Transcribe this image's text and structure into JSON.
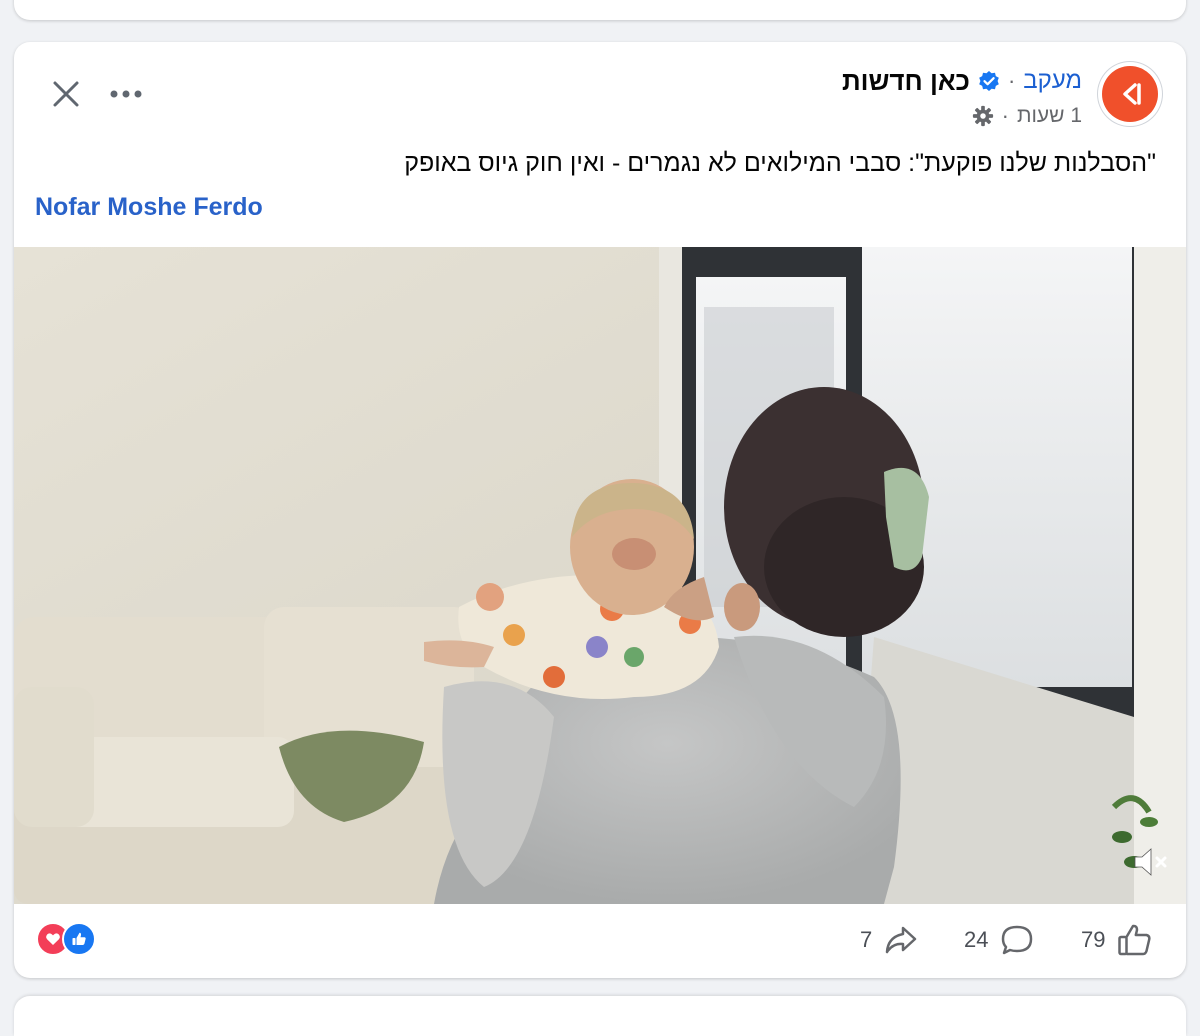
{
  "post": {
    "page_name": "כאן חדשות",
    "follow_label": "מעקב",
    "separator": "·",
    "time": "1 שעות",
    "text": "\"הסבלנות שלנו פוקעת\": סבבי המילואים לא נגמרים - ואין חוק גיוס באופק",
    "author_tag": "Nofar Moshe Ferdo"
  },
  "icons": {
    "close": "close-icon",
    "more": "more-icon",
    "verified": "verified-badge-icon",
    "privacy": "gear-icon",
    "mute": "speaker-muted-icon",
    "love": "love-reaction-icon",
    "like": "like-reaction-icon",
    "share": "share-icon",
    "comment": "comment-icon",
    "thumb": "thumbs-up-icon"
  },
  "stats": {
    "shares": "7",
    "comments": "24",
    "likes": "79"
  },
  "colors": {
    "brand": "#f0502b",
    "link": "#2962c9",
    "verified": "#1877f2"
  }
}
